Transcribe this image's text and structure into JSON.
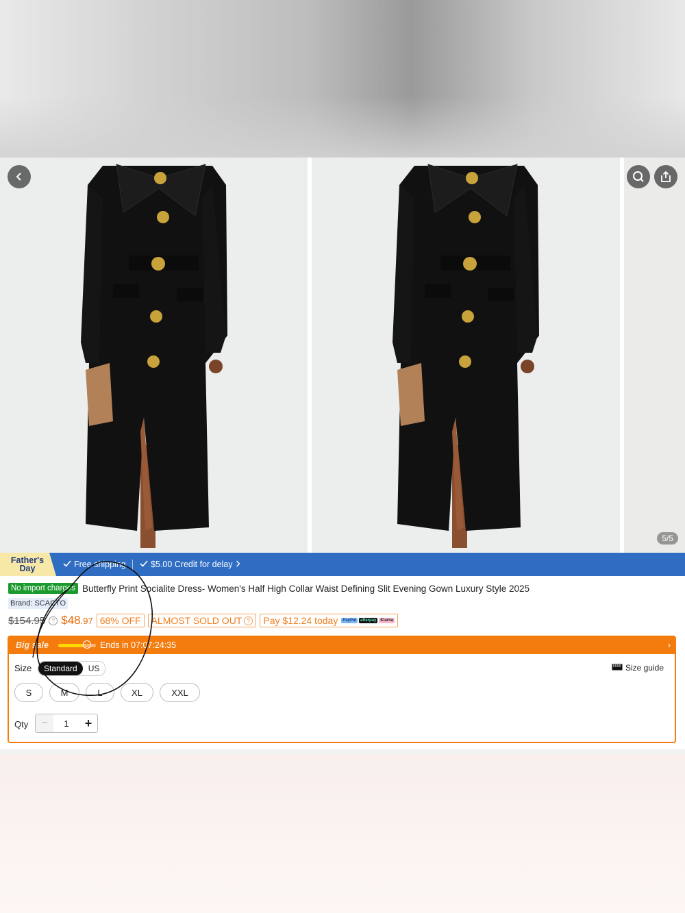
{
  "gallery": {
    "counter": "5/5",
    "icons": [
      "back-chevron-icon",
      "search-icon",
      "share-icon"
    ]
  },
  "promo": {
    "fathers_day": "Father's Day",
    "free_shipping": "Free shipping",
    "credit": "$5.00 Credit for delay",
    "bar_color": "#2f6dc2"
  },
  "product": {
    "badge": "No import charges",
    "title": "Butterfly Print Socialite Dress- Women's Half High Collar Waist Defining Slit Evening Gown Luxury Style 2025",
    "brand": "Brand: SCACTO",
    "old_price": "$154.95",
    "price_main": "$48",
    "price_cents": ".97",
    "discount": "68% OFF",
    "sold_out": "ALMOST SOLD OUT",
    "pay_today": "Pay $12.24 today",
    "pay_logos": [
      "PayPal",
      "afterpay",
      "Klarna"
    ],
    "accent_color": "#f47c0f"
  },
  "sale": {
    "label": "Big sale",
    "ends": "Ends in 07:07:24:35",
    "progress": 0.65
  },
  "size": {
    "label": "Size",
    "systems": [
      "Standard",
      "US"
    ],
    "selected_system": "Standard",
    "guide": "Size guide",
    "options": [
      "S",
      "M",
      "L",
      "XL",
      "XXL"
    ]
  },
  "qty": {
    "label": "Qty",
    "minus": "−",
    "value": "1",
    "plus": "+"
  }
}
